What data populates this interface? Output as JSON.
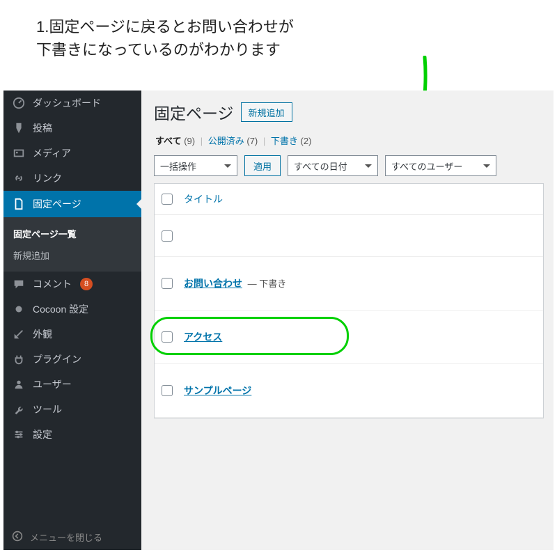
{
  "annotation": {
    "line1": "1.固定ページに戻るとお問い合わせが",
    "line2": "下書きになっているのがわかります"
  },
  "sidebar": {
    "items": [
      {
        "label": "ダッシュボード",
        "icon": "dashboard"
      },
      {
        "label": "投稿",
        "icon": "pin"
      },
      {
        "label": "メディア",
        "icon": "media"
      },
      {
        "label": "リンク",
        "icon": "link"
      },
      {
        "label": "固定ページ",
        "icon": "page",
        "active": true
      },
      {
        "label": "コメント",
        "icon": "comment",
        "badge": "8"
      },
      {
        "label": "Cocoon 設定",
        "icon": "dot"
      },
      {
        "label": "外観",
        "icon": "brush"
      },
      {
        "label": "プラグイン",
        "icon": "plug"
      },
      {
        "label": "ユーザー",
        "icon": "user"
      },
      {
        "label": "ツール",
        "icon": "wrench"
      },
      {
        "label": "設定",
        "icon": "sliders"
      }
    ],
    "submenu": [
      {
        "label": "固定ページ一覧",
        "current": true
      },
      {
        "label": "新規追加"
      }
    ],
    "collapse_label": "メニューを閉じる"
  },
  "page": {
    "title": "固定ページ",
    "add_new": "新規追加",
    "filters": {
      "all_label": "すべて",
      "all_count": "(9)",
      "published_label": "公開済み",
      "published_count": "(7)",
      "draft_label": "下書き",
      "draft_count": "(2)"
    },
    "bulk_action": "一括操作",
    "apply": "適用",
    "date_filter": "すべての日付",
    "user_filter": "すべてのユーザー",
    "column_title": "タイトル"
  },
  "rows": [
    {
      "title": "",
      "status": ""
    },
    {
      "title": "お問い合わせ",
      "status": "— 下書き"
    },
    {
      "title": "アクセス",
      "status": ""
    },
    {
      "title": "サンプルページ",
      "status": ""
    }
  ]
}
